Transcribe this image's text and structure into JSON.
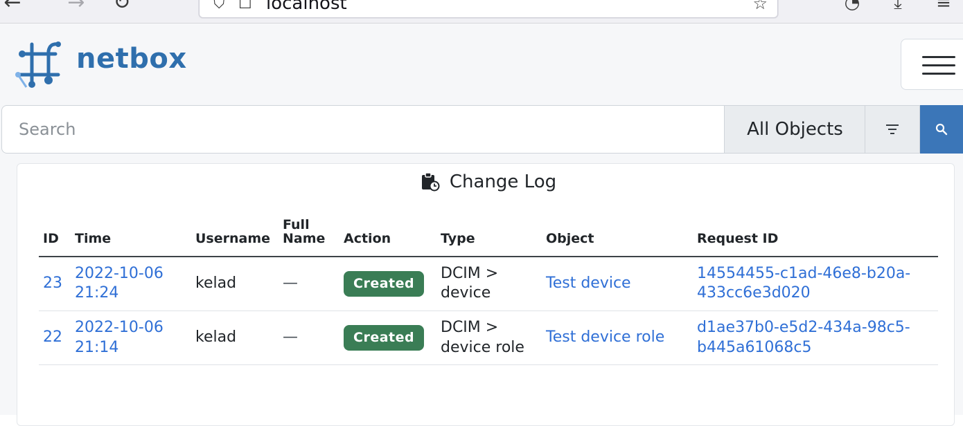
{
  "browser": {
    "url": "localhost"
  },
  "header": {
    "brand": "netbox"
  },
  "search": {
    "placeholder": "Search",
    "scope": "All Objects"
  },
  "card": {
    "title": "Change Log"
  },
  "table": {
    "columns": {
      "id": "ID",
      "time": "Time",
      "username": "Username",
      "full_name": "Full Name",
      "action": "Action",
      "type": "Type",
      "object": "Object",
      "request_id": "Request ID"
    },
    "rows": [
      {
        "id": "23",
        "time": "2022-10-06 21:24",
        "username": "kelad",
        "full_name": "—",
        "action": "Created",
        "type": "DCIM > device",
        "object": "Test device",
        "request_id": "14554455-c1ad-46e8-b20a-433cc6e3d020"
      },
      {
        "id": "22",
        "time": "2022-10-06 21:14",
        "username": "kelad",
        "full_name": "—",
        "action": "Created",
        "type": "DCIM > device role",
        "object": "Test device role",
        "request_id": "d1ae37b0-e5d2-434a-98c5-b445a61068c5"
      }
    ]
  },
  "colors": {
    "brand": "#2f6fad",
    "link": "#2f6fd6",
    "badge_created": "#3a7d55",
    "search_button": "#3b76b8"
  }
}
